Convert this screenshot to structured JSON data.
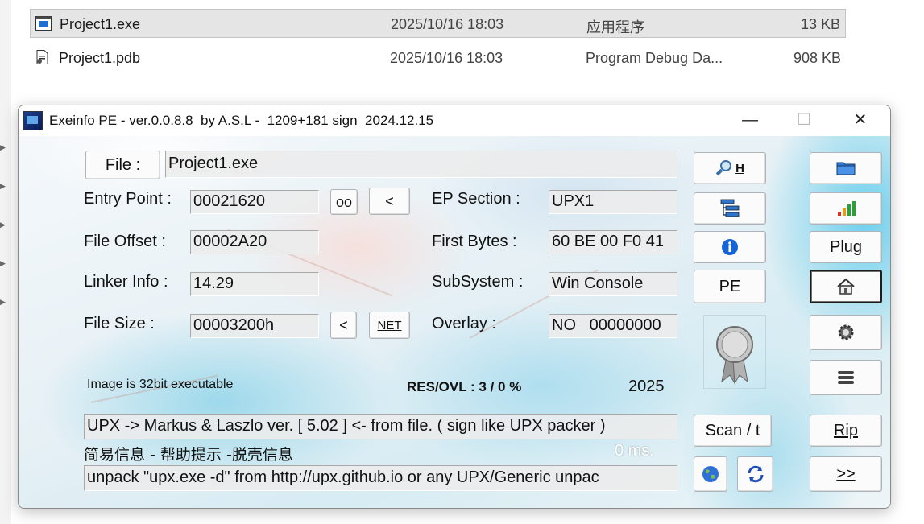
{
  "explorer": {
    "files": [
      {
        "name": "Project1.exe",
        "date": "2025/10/16 18:03",
        "type": "应用程序",
        "size": "13 KB",
        "icon": "exe-file-icon"
      },
      {
        "name": "Project1.pdb",
        "date": "2025/10/16 18:03",
        "type": "Program Debug Da...",
        "size": "908 KB",
        "icon": "pdb-file-icon"
      }
    ]
  },
  "window": {
    "title": "Exeinfo PE - ver.0.0.8.8  by A.S.L -  1209+181 sign  2024.12.15",
    "controls": {
      "minimize": "—",
      "maximize": "☐",
      "close": "✕"
    }
  },
  "file_label": "File :",
  "file_value": "Project1.exe",
  "fields": {
    "entry_point": {
      "label": "Entry Point :",
      "value": "00021620"
    },
    "file_offset": {
      "label": "File Offset :",
      "value": "00002A20"
    },
    "linker_info": {
      "label": "Linker Info :",
      "value": "14.29"
    },
    "file_size": {
      "label": "File Size :",
      "value": "00003200h"
    },
    "ep_section": {
      "label": "EP Section :",
      "value": "UPX1"
    },
    "first_bytes": {
      "label": "First Bytes :",
      "value": "60 BE 00 F0 41"
    },
    "subsystem": {
      "label": "SubSystem :",
      "value": "Win Console"
    },
    "overlay": {
      "label": "Overlay :",
      "value": "NO   00000000"
    }
  },
  "small_buttons": {
    "oo": "oo",
    "back1": "<",
    "back2": "<",
    "net": "NET"
  },
  "image_info": "Image is 32bit executable",
  "res_ovl": "RES/OVL : 3 / 0 %",
  "year": "2025",
  "detect": "UPX -> Markus & Laszlo ver. [ 5.02 ] <- from file. ( sign like UPX packer )",
  "help_text": "简易信息 - 帮助提示 -脱壳信息",
  "time": "0 ms.",
  "hint": "unpack \"upx.exe -d\"  from  http://upx.github.io or any UPX/Generic unpac",
  "right_buttons": {
    "h": "H",
    "pe": "PE",
    "plug": "Plug",
    "scan": "Scan / t",
    "rip": "Rip",
    "next": ">>"
  },
  "colors": {
    "accent_blue": "#1565d8",
    "title_bg": "#ffffff",
    "pressed_border": "#1d1d1d"
  }
}
